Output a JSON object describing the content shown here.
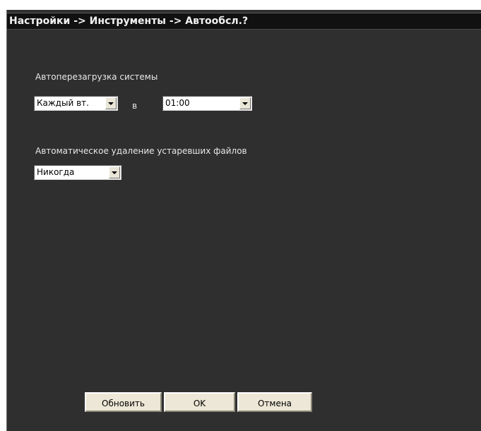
{
  "window": {
    "title": "Настройки -> Инструменты -> Автообсл.?"
  },
  "auto_reboot": {
    "label": "Автоперезагрузка системы",
    "day_value": "Каждый вт.",
    "at_label": "в",
    "time_value": "01:00"
  },
  "auto_delete": {
    "label": "Автоматическое удаление устаревших файлов",
    "value": "Никогда"
  },
  "buttons": {
    "refresh_label": "Обновить",
    "ok_label": "OK",
    "cancel_label": "Отмена"
  },
  "colors": {
    "background": "#2f2f2f",
    "titlebar": "#111111",
    "text": "#e8e8e8",
    "button_face": "#ece7d6"
  }
}
